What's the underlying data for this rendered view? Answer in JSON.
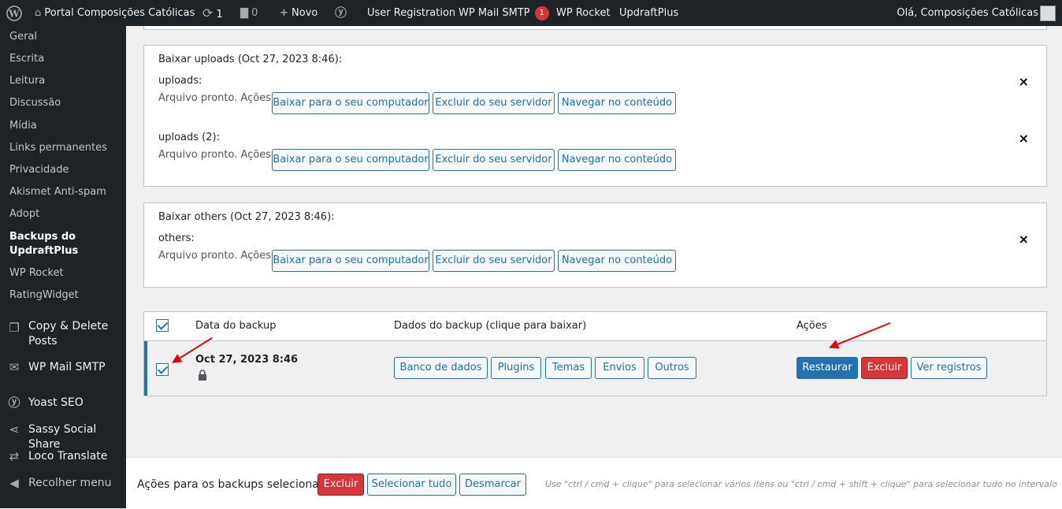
{
  "adminbar": {
    "site_name": "Portal Composições Católicas",
    "updates_count": "1",
    "comments_count": "0",
    "new_label": "Novo",
    "user_registration": "User Registration",
    "wp_mail_smtp": "WP Mail SMTP",
    "wp_mail_smtp_badge": "1",
    "wp_rocket": "WP Rocket",
    "updraftplus": "UpdraftPlus",
    "greeting": "Olá, Composições Católicas"
  },
  "sidebar": {
    "submenu": [
      "Geral",
      "Escrita",
      "Leitura",
      "Discussão",
      "Mídia",
      "Links permanentes",
      "Privacidade",
      "Akismet Anti-spam",
      "Adopt"
    ],
    "current_line1": "Backups do",
    "current_line2": "UpdraftPlus",
    "submenu_after": [
      "WP Rocket",
      "RatingWidget"
    ],
    "copy_delete_line1": "Copy & Delete",
    "copy_delete_line2": "Posts",
    "wp_mail_smtp": "WP Mail SMTP",
    "yoast": "Yoast SEO",
    "sassy": "Sassy Social Share",
    "loco": "Loco Translate",
    "collapse": "Recolher menu"
  },
  "downloads": {
    "uploads_title": "Baixar uploads (Oct 27, 2023 8:46):",
    "uploads_label": "uploads:",
    "uploads2_label": "uploads (2):",
    "others_title": "Baixar others (Oct 27, 2023 8:46):",
    "others_label": "others:",
    "status": "Arquivo pronto. Ações:",
    "btn_download": "Baixar para o seu computador",
    "btn_delete": "Excluir do seu servidor",
    "btn_browse": "Navegar no conteúdo",
    "close": "×"
  },
  "table": {
    "col_date": "Data do backup",
    "col_data": "Dados do backup (clique para baixar)",
    "col_actions": "Ações",
    "row": {
      "date": "Oct 27, 2023 8:46",
      "components": [
        "Banco de dados",
        "Plugins",
        "Temas",
        "Envios",
        "Outros"
      ],
      "restore": "Restaurar",
      "delete": "Excluir",
      "logs": "Ver registros"
    }
  },
  "bulk": {
    "label": "Ações para os backups selecionados",
    "delete": "Excluir",
    "select_all": "Selecionar tudo",
    "deselect": "Desmarcar",
    "hint": "Use \"ctrl / cmd + clique\" para selecionar vários itens ou \"ctrl / cmd + shift + clique\" para selecionar tudo no intervalo"
  },
  "colors": {
    "accent": "#2271b1",
    "danger": "#d63638",
    "annotation": "#ee0000"
  }
}
